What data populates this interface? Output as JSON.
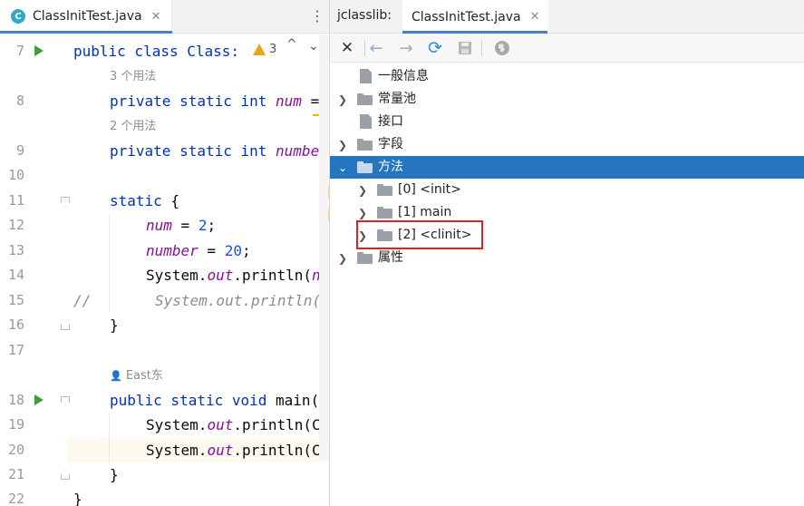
{
  "editor": {
    "tab_label": "ClassInitTest.java",
    "tab_icon": "C",
    "warning_count": "3",
    "lines": [
      {
        "num": "7",
        "run": true
      },
      {
        "num": "8"
      },
      {
        "num": "9"
      },
      {
        "num": "10"
      },
      {
        "num": "11"
      },
      {
        "num": "12"
      },
      {
        "num": "13"
      },
      {
        "num": "14"
      },
      {
        "num": "15"
      },
      {
        "num": "16"
      },
      {
        "num": "17"
      },
      {
        "num": "18",
        "run": true
      },
      {
        "num": "19"
      },
      {
        "num": "20"
      },
      {
        "num": "21"
      },
      {
        "num": "22"
      }
    ],
    "usage_hints": [
      "3 个用法",
      "2 个用法"
    ],
    "author_hint": "East东",
    "code": {
      "l7": "public class Class:",
      "l8a": "private static int ",
      "l8b": "num",
      "l8c": " =",
      "l9a": "private static int ",
      "l9b": "number",
      "l11a": "static",
      "l11b": " {",
      "l12a": "num",
      "l12b": " = ",
      "l12c": "2",
      "l12d": ";",
      "l13a": "number",
      "l13b": " = ",
      "l13c": "20",
      "l13d": ";",
      "l14a": "System.",
      "l14b": "out",
      "l14c": ".println(",
      "l14d": "n",
      "l15a": "//",
      "l15b": "System.out.println(",
      "l16": "}",
      "l18a": "public static void ",
      "l18b": "main(",
      "l19a": "System.",
      "l19b": "out",
      "l19c": ".println(C",
      "l20a": "System.",
      "l20b": "out",
      "l20c": ".println(C",
      "l21": "}",
      "l22": "}"
    }
  },
  "jclasslib": {
    "title": "jclasslib:",
    "tab_label": "ClassInitTest.java",
    "toolbar": [
      "close-icon",
      "back-arrow-icon",
      "forward-arrow-icon",
      "refresh-icon",
      "save-icon",
      "browser-icon"
    ],
    "tree": [
      {
        "label": "一般信息",
        "type": "file",
        "expandable": false,
        "level": 0
      },
      {
        "label": "常量池",
        "type": "folder",
        "expandable": true,
        "expanded": false,
        "level": 0
      },
      {
        "label": "接口",
        "type": "file",
        "expandable": false,
        "level": 0
      },
      {
        "label": "字段",
        "type": "folder",
        "expandable": true,
        "expanded": false,
        "level": 0
      },
      {
        "label": "方法",
        "type": "folder",
        "expandable": true,
        "expanded": true,
        "level": 0,
        "selected": true
      },
      {
        "label": "[0] <init>",
        "type": "folder",
        "expandable": true,
        "expanded": false,
        "level": 1
      },
      {
        "label": "[1] main",
        "type": "folder",
        "expandable": true,
        "expanded": false,
        "level": 1
      },
      {
        "label": "[2] <clinit>",
        "type": "folder",
        "expandable": true,
        "expanded": false,
        "level": 1,
        "highlighted": true
      },
      {
        "label": "属性",
        "type": "folder",
        "expandable": true,
        "expanded": false,
        "level": 0
      }
    ]
  },
  "colors": {
    "selection": "#2675bf",
    "highlight_box": "#e02020",
    "keyword": "#0033b3",
    "field": "#871094",
    "number": "#1750eb",
    "run_icon": "#3f9c3f",
    "warning": "#e3a812"
  }
}
